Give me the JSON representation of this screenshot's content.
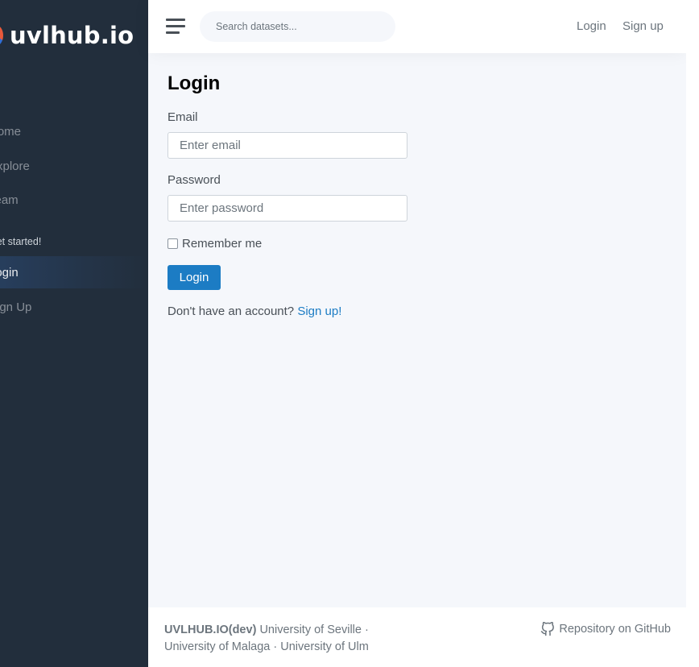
{
  "sidebar": {
    "brand": "uvlhub.io",
    "items": [
      {
        "label": "Home"
      },
      {
        "label": "Explore"
      },
      {
        "label": "Team"
      }
    ],
    "section_header": "Get started!",
    "auth_items": [
      {
        "label": "Login",
        "active": true
      },
      {
        "label": "Sign Up",
        "active": false
      }
    ]
  },
  "topbar": {
    "search_placeholder": "Search datasets...",
    "login_label": "Login",
    "signup_label": "Sign up"
  },
  "main": {
    "title": "Login",
    "email_label": "Email",
    "email_placeholder": "Enter email",
    "password_label": "Password",
    "password_placeholder": "Enter password",
    "remember_label": "Remember me",
    "submit_label": "Login",
    "no_account_text": "Don't have an account?",
    "signup_link": "Sign up!"
  },
  "footer": {
    "brand": "UVLHUB.IO(dev)",
    "affiliations": "University of Seville · University of Malaga · University of Ulm",
    "repo_label": "Repository on GitHub"
  },
  "colors": {
    "sidebar_bg": "#222e3c",
    "page_bg": "#f5f7fb",
    "primary": "#1c7cc4"
  }
}
